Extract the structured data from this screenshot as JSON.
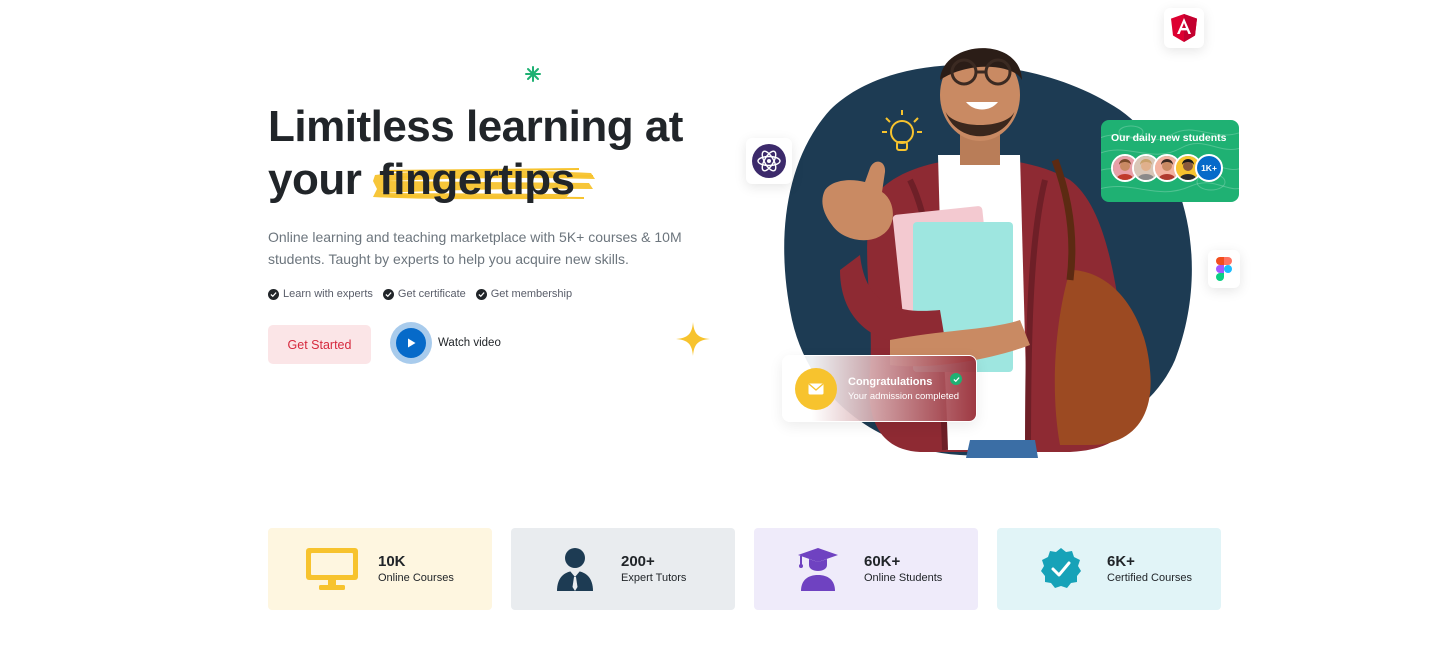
{
  "hero": {
    "title_line1": "Limitless learning at",
    "title_prefix": "your",
    "title_highlight": "fingertips",
    "description": "Online learning and teaching marketplace with 5K+ courses & 10M students. Taught by experts to help you acquire new skills.",
    "features": [
      "Learn with experts",
      "Get certificate",
      "Get membership"
    ],
    "cta_label": "Get Started",
    "watch_label": "Watch video"
  },
  "cards": {
    "students_title": "Our daily new students",
    "students_count": "1K+",
    "congrats_title": "Congratulations",
    "congrats_sub": "Your admission completed"
  },
  "stats": [
    {
      "value": "10K",
      "label": "Online Courses",
      "icon": "monitor-icon",
      "bg": "#fef6e0",
      "accent": "#f7c32e"
    },
    {
      "value": "200+",
      "label": "Expert Tutors",
      "icon": "tutor-icon",
      "bg": "#e9ecef",
      "accent": "#1d3b53"
    },
    {
      "value": "60K+",
      "label": "Online Students",
      "icon": "graduate-icon",
      "bg": "#efebfa",
      "accent": "#6f42c1"
    },
    {
      "value": "6K+",
      "label": "Certified Courses",
      "icon": "certified-badge-icon",
      "bg": "#e1f4f7",
      "accent": "#17a2b8"
    }
  ],
  "colors": {
    "primary": "#066ac9",
    "danger": "#d6293e",
    "warning": "#f7c32e",
    "success": "#1fb173",
    "dark_blue": "#1d3b53"
  }
}
